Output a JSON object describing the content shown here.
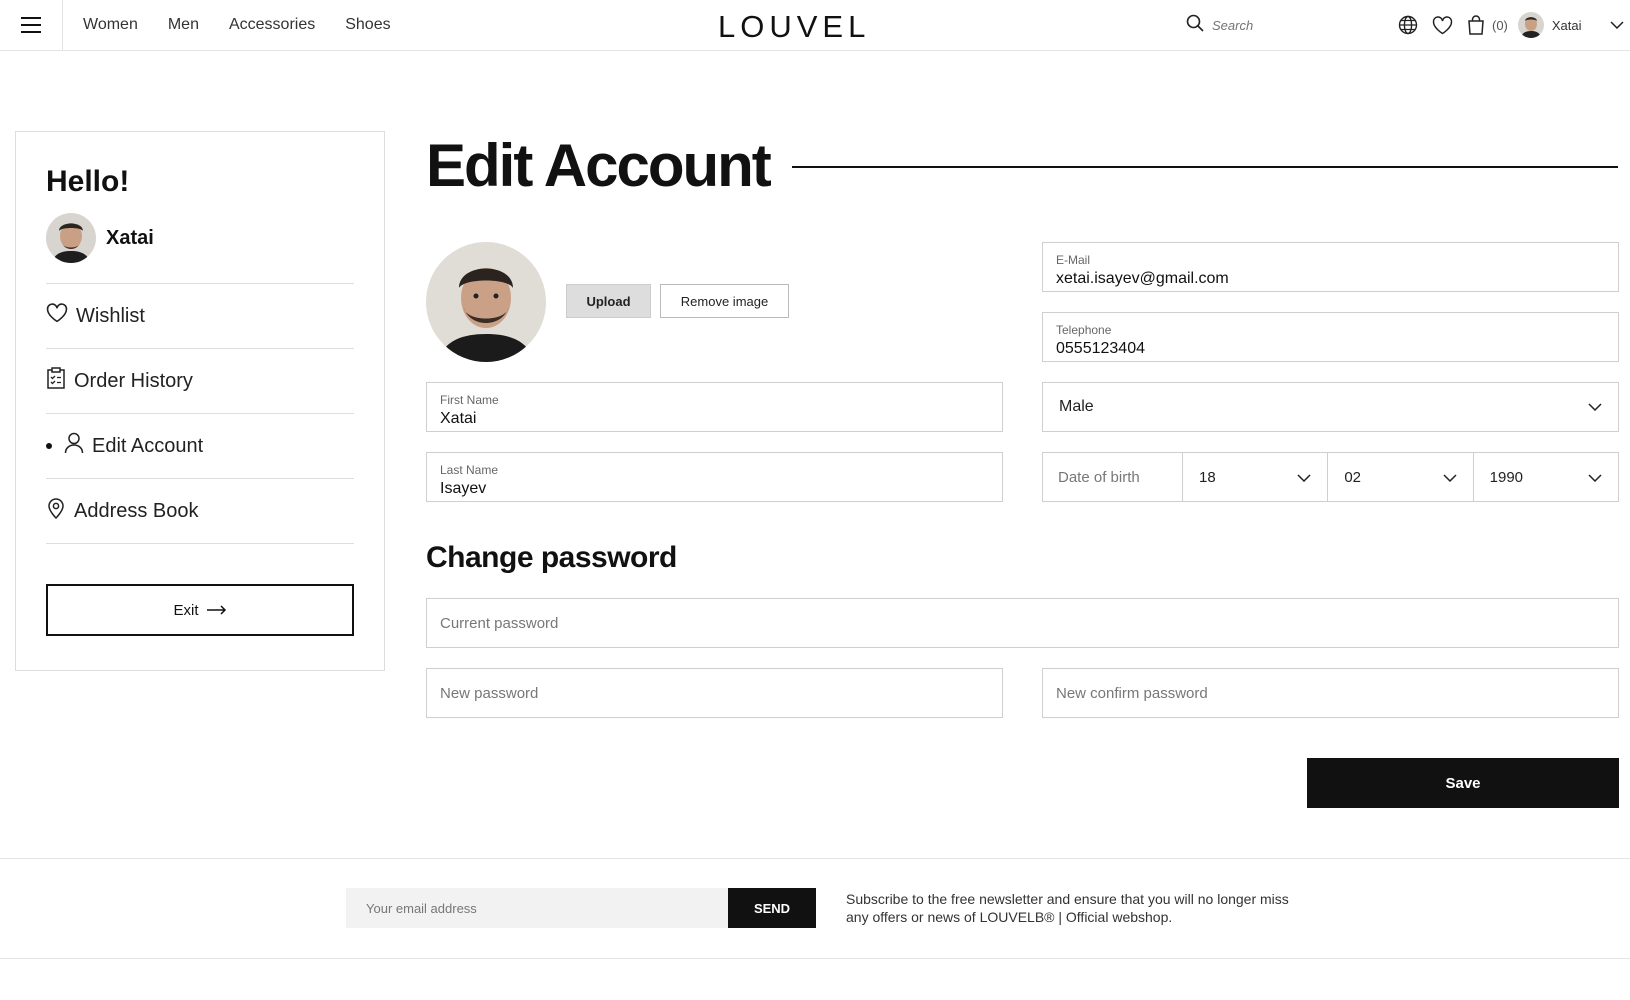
{
  "header": {
    "nav": [
      "Women",
      "Men",
      "Accessories",
      "Shoes"
    ],
    "logo": "LOUVEL",
    "search_placeholder": "Search",
    "cart_count": "(0)",
    "username": "Xatai"
  },
  "sidebar": {
    "greeting": "Hello!",
    "username": "Xatai",
    "items": [
      {
        "label": "Wishlist",
        "icon": "heart-icon"
      },
      {
        "label": "Order History",
        "icon": "clipboard-icon"
      },
      {
        "label": "Edit Account",
        "icon": "user-icon",
        "active": true
      },
      {
        "label": "Address Book",
        "icon": "location-pin-icon"
      }
    ],
    "exit_label": "Exit"
  },
  "main": {
    "title": "Edit Account",
    "upload_label": "Upload",
    "remove_label": "Remove image",
    "email": {
      "label": "E-Mail",
      "value": "xetai.isayev@gmail.com"
    },
    "telephone": {
      "label": "Telephone",
      "value": "0555123404"
    },
    "first_name": {
      "label": "First Name",
      "value": "Xatai"
    },
    "last_name": {
      "label": "Last Name",
      "value": "Isayev"
    },
    "gender": "Male",
    "dob": {
      "label": "Date of birth",
      "day": "18",
      "month": "02",
      "year": "1990"
    },
    "change_password_title": "Change password",
    "current_password_placeholder": "Current password",
    "new_password_placeholder": "New password",
    "confirm_password_placeholder": "New confirm password",
    "save_label": "Save"
  },
  "newsletter": {
    "placeholder": "Your email address",
    "send_label": "SEND",
    "text": "Subscribe to the free newsletter and ensure that you will no longer miss any offers or news of LOUVELB® | Official webshop."
  }
}
